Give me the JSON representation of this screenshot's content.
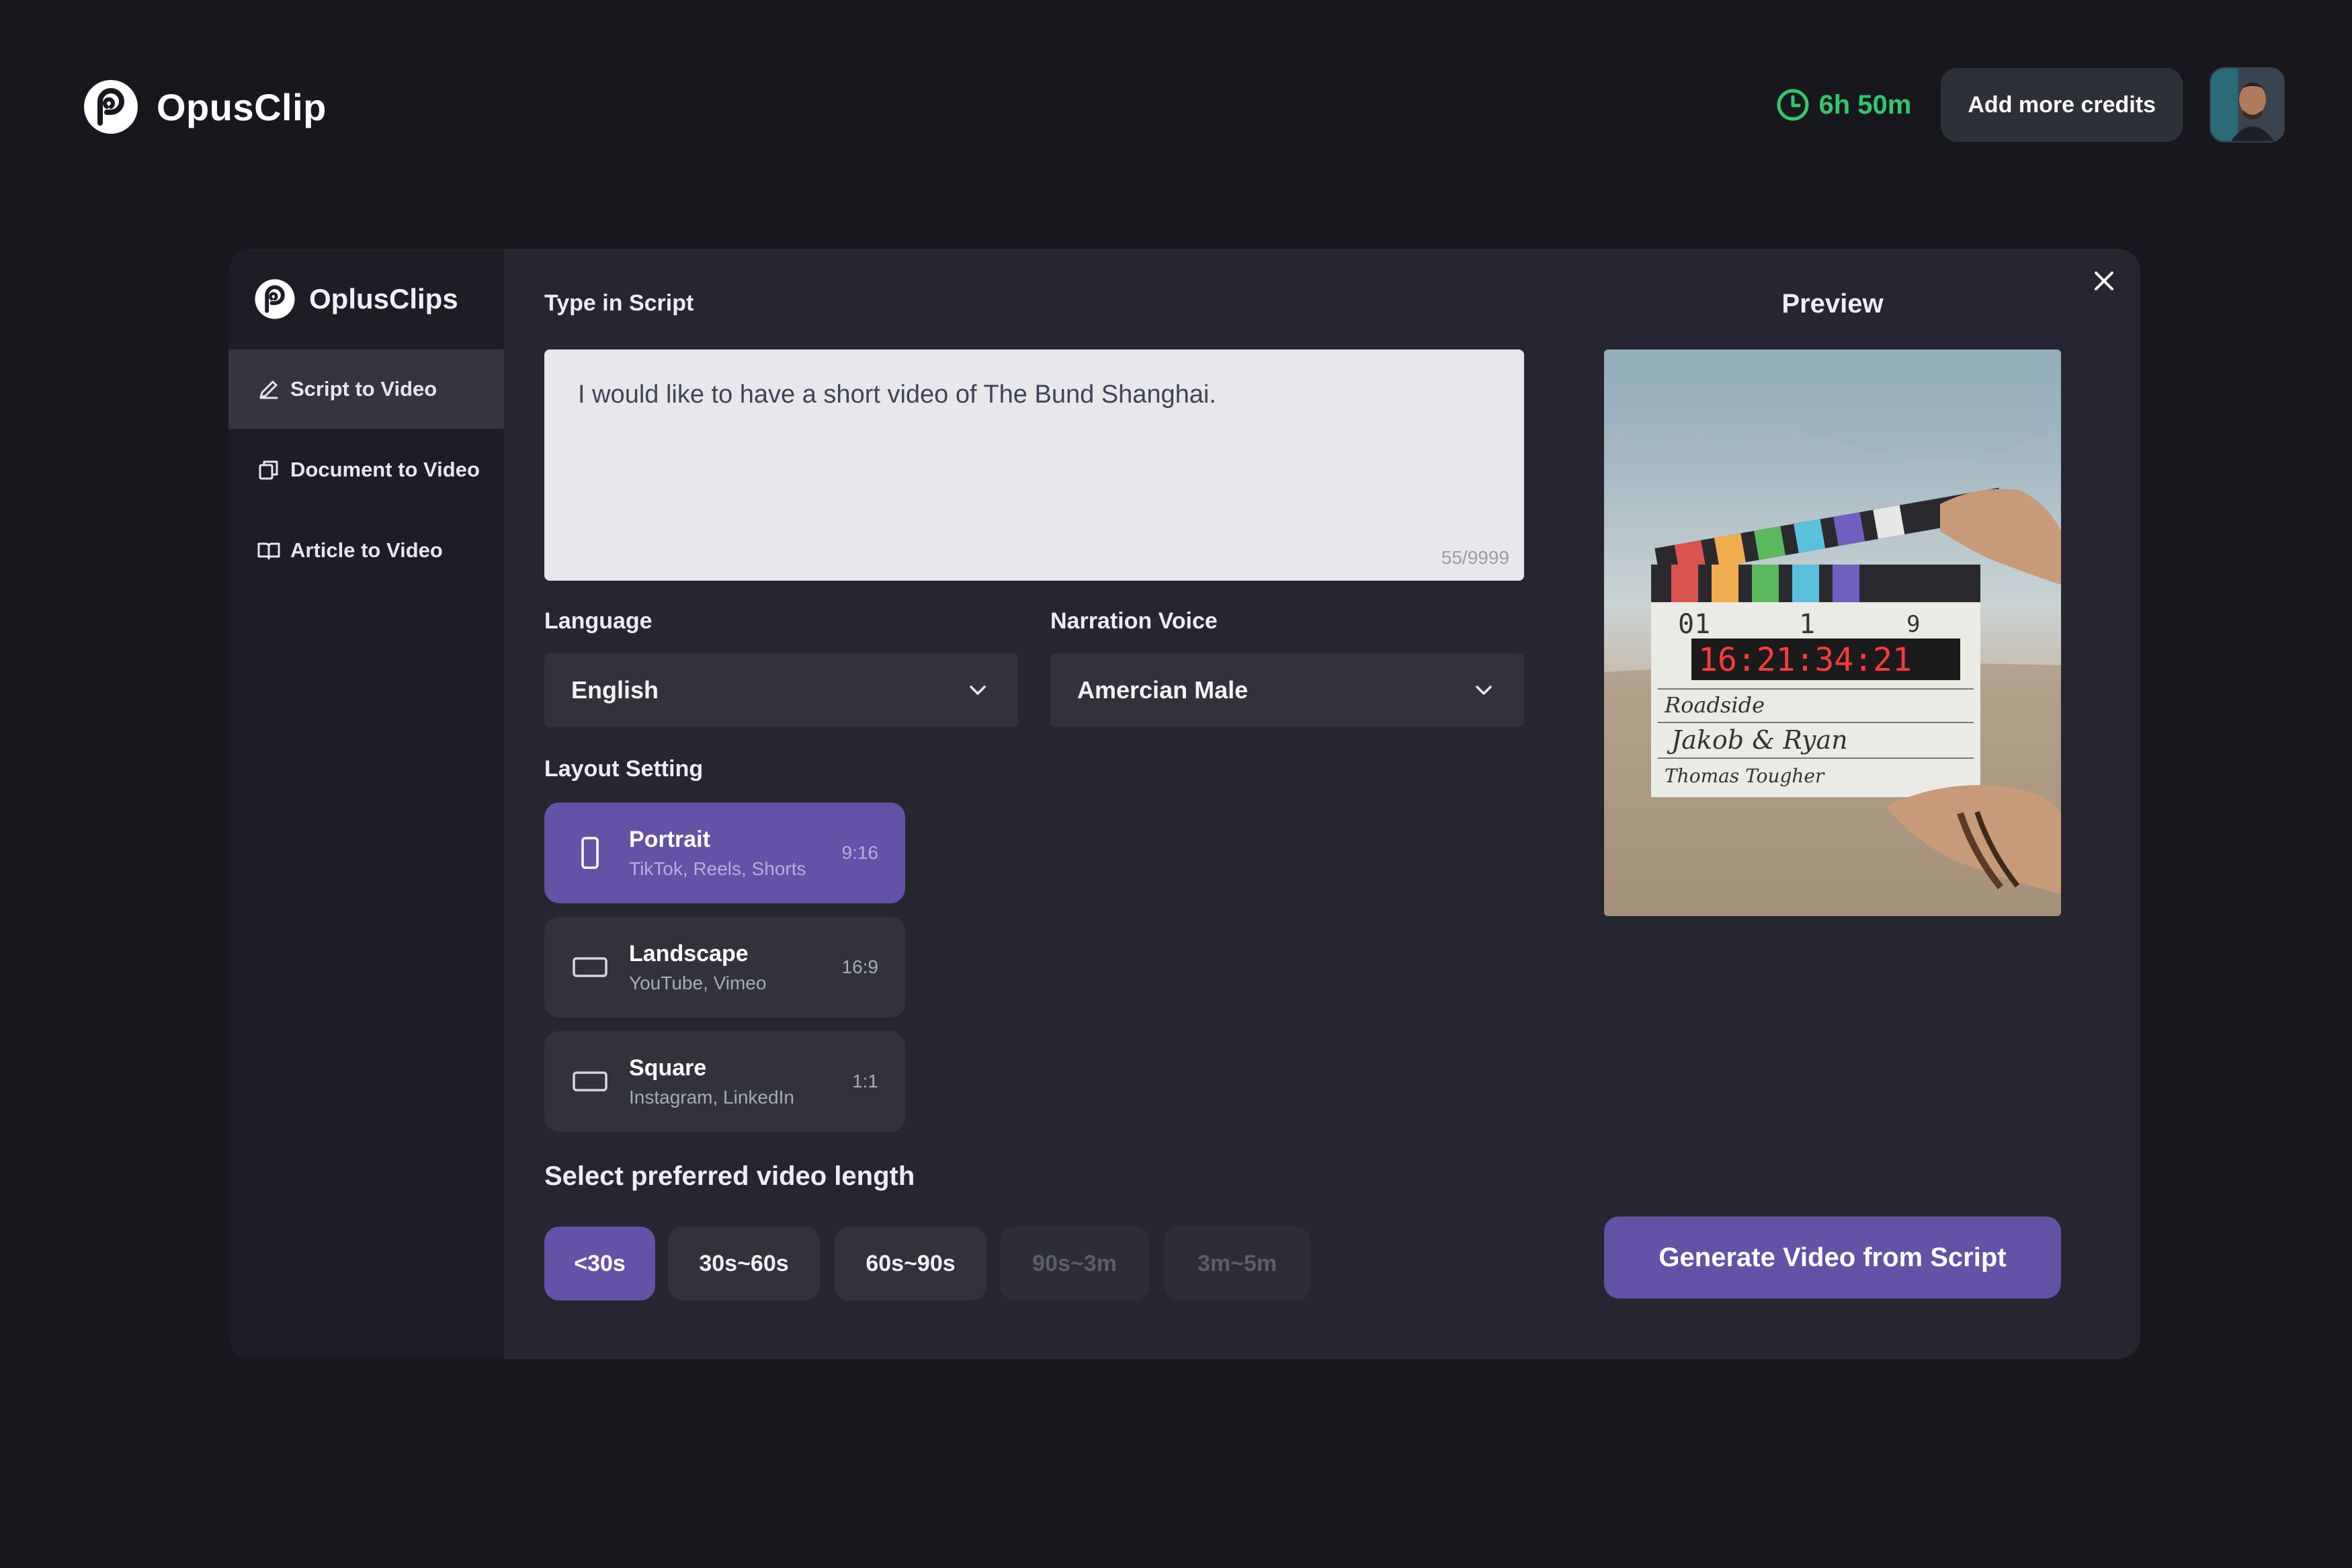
{
  "app": {
    "brand_name": "OpusClip"
  },
  "header": {
    "timer_text": "6h 50m",
    "credits_button": "Add more credits",
    "accent_color": "#35c66b"
  },
  "modal": {
    "brand_name": "OplusClips",
    "nav": [
      {
        "label": "Script to Video",
        "icon": "pencil-icon",
        "active": true
      },
      {
        "label": "Document to Video",
        "icon": "document-copy-icon",
        "active": false
      },
      {
        "label": "Article to Video",
        "icon": "book-icon",
        "active": false
      }
    ],
    "script": {
      "label": "Type in Script",
      "value": "I would like to have a short video of The Bund Shanghai.",
      "counter": "55/9999"
    },
    "language": {
      "label": "Language",
      "value": "English"
    },
    "voice": {
      "label": "Narration Voice",
      "value": "Amercian Male"
    },
    "layout": {
      "label": "Layout Setting",
      "options": [
        {
          "title": "Portrait",
          "sub": "TikTok, Reels, Shorts",
          "ratio": "9:16",
          "selected": true
        },
        {
          "title": "Landscape",
          "sub": "YouTube, Vimeo",
          "ratio": "16:9",
          "selected": false
        },
        {
          "title": "Square",
          "sub": "Instagram, LinkedIn",
          "ratio": "1:1",
          "selected": false
        }
      ]
    },
    "length": {
      "label": "Select preferred video length",
      "options": [
        {
          "label": "<30s",
          "state": "selected"
        },
        {
          "label": "30s~60s",
          "state": "normal"
        },
        {
          "label": "60s~90s",
          "state": "normal"
        },
        {
          "label": "90s~3m",
          "state": "disabled"
        },
        {
          "label": "3m~5m",
          "state": "disabled"
        }
      ]
    },
    "preview": {
      "title": "Preview",
      "clapper": {
        "roll": "01",
        "scene": "1",
        "take": "9",
        "timecode": "16:21:34:21",
        "line1": "Roadside",
        "line2": "Jakob & Ryan",
        "line3": "Thomas Tougher"
      }
    },
    "generate_button": "Generate Video from Script",
    "accent_color": "#6452a6"
  }
}
